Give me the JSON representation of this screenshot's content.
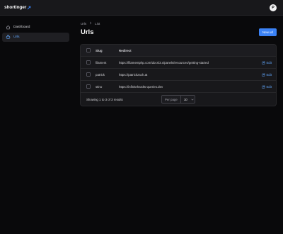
{
  "brand": {
    "name": "shortinger"
  },
  "user": {
    "initial": "P"
  },
  "sidebar": {
    "items": [
      {
        "label": "Dashboard"
      },
      {
        "label": "Urls"
      }
    ]
  },
  "breadcrumb": {
    "items": [
      "Urls",
      "List"
    ]
  },
  "page": {
    "title": "Urls",
    "new_button": "New url"
  },
  "table": {
    "columns": [
      "Slug",
      "Redirect"
    ],
    "edit_label": "Edit",
    "rows": [
      {
        "slug": "filament",
        "redirect": "https://filamentphp.com/docs/3.x/panels/resources/getting-started"
      },
      {
        "slug": "patrick",
        "redirect": "https://patrickzach.at"
      },
      {
        "slug": "stino",
        "redirect": "https://infinitehardts-queries.dev"
      }
    ]
  },
  "pagination": {
    "summary": "Showing 1 to 3 of 3 results",
    "per_page_label": "Per page",
    "per_page_value": "10"
  },
  "colors": {
    "accent": "#3b82f6",
    "link": "#60a5fa",
    "background": "#09090b",
    "surface": "#18181b"
  }
}
